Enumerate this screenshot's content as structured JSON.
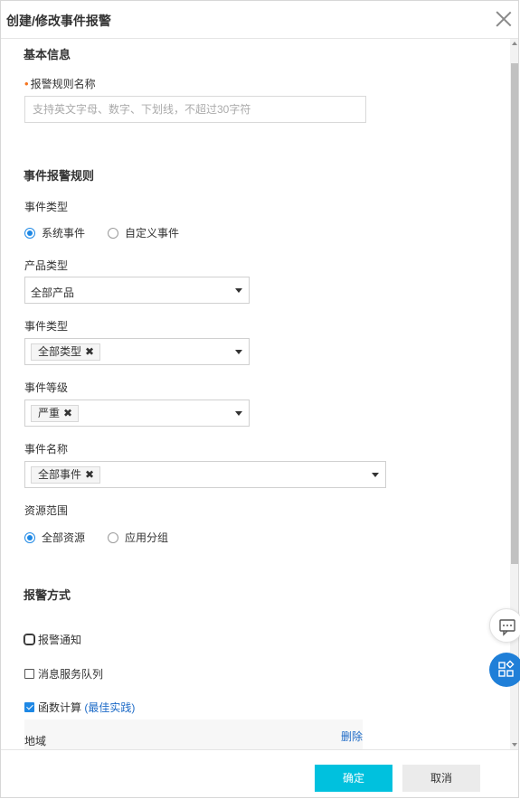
{
  "dialog": {
    "title": "创建/修改事件报警"
  },
  "basic": {
    "section_title": "基本信息",
    "rule_name_label": "报警规则名称",
    "rule_name_value": "",
    "rule_name_placeholder": "支持英文字母、数字、下划线，不超过30字符"
  },
  "event_rule": {
    "section_title": "事件报警规则",
    "event_type_label": "事件类型",
    "event_type_options": [
      {
        "label": "系统事件",
        "selected": true
      },
      {
        "label": "自定义事件",
        "selected": false
      }
    ],
    "product_type_label": "产品类型",
    "product_type_value": "全部产品",
    "event_category_label": "事件类型",
    "event_category_tag": "全部类型",
    "event_level_label": "事件等级",
    "event_level_tag": "严重",
    "event_name_label": "事件名称",
    "event_name_tag": "全部事件",
    "resource_scope_label": "资源范围",
    "resource_scope_options": [
      {
        "label": "全部资源",
        "selected": true
      },
      {
        "label": "应用分组",
        "selected": false
      }
    ]
  },
  "alarm_method": {
    "section_title": "报警方式",
    "options": [
      {
        "label": "报警通知",
        "checked": false
      },
      {
        "label": "消息服务队列",
        "checked": false
      },
      {
        "label": "函数计算",
        "checked": true,
        "link": "(最佳实践)"
      }
    ],
    "region_label": "地域",
    "delete_label": "删除"
  },
  "footer": {
    "ok_label": "确定",
    "cancel_label": "取消"
  },
  "colors": {
    "primary": "#00c1de",
    "accent_blue": "#1e88e5",
    "required_marker": "#f5741f"
  },
  "icons": {
    "close": "close-icon",
    "chat": "chat-icon",
    "apps": "apps-icon"
  }
}
